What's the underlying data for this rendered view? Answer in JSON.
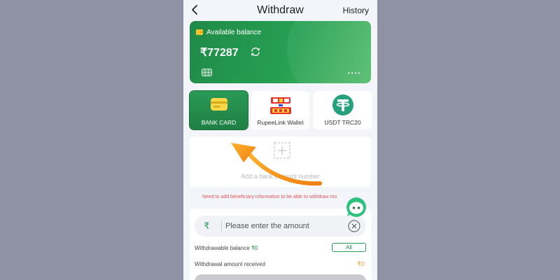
{
  "header": {
    "title": "Withdraw",
    "history_label": "History"
  },
  "balance_card": {
    "label": "Available balance",
    "amount": "₹77287",
    "masked": "••••"
  },
  "methods": [
    {
      "label": "BANK CARD",
      "icon": "bank-card-icon",
      "active": true
    },
    {
      "label": "RupeeLink Wallet",
      "icon": "rupeelink-logo",
      "active": false
    },
    {
      "label": "USDT TRC20",
      "icon": "usdt-icon",
      "active": false
    }
  ],
  "add_account": {
    "text": "Add a bank account number"
  },
  "notice": "Need to add beneficiary information to be able to withdraw mo",
  "amount": {
    "currency": "₹",
    "placeholder": "Please enter the amount",
    "value": ""
  },
  "withdrawable": {
    "label": "Withdrawable balance ",
    "value": "₹0",
    "all_label": "All"
  },
  "received": {
    "label": "Withdrawal amount received",
    "value": "₹0"
  },
  "colors": {
    "accent": "#1f8a48",
    "warning": "#e85555",
    "amount": "#f29b38",
    "overlay_arrow": "#f39a1e"
  }
}
